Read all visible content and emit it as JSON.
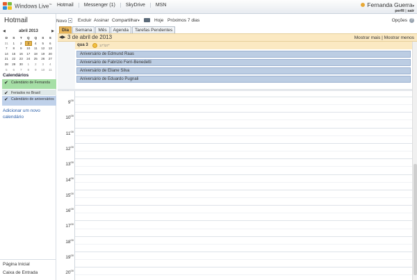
{
  "topbar": {
    "logo_text": "Windows Live",
    "logo_tm": "™",
    "nav": [
      "Hotmail",
      "Messenger (1)",
      "SkyDrive",
      "MSN"
    ],
    "user_name": "Fernanda Guerra",
    "user_links": [
      "perfil",
      "sair"
    ]
  },
  "left": {
    "brand": "Hotmail",
    "mini_calendar": {
      "month_label": "abril 2013",
      "weekday_headers": [
        "D",
        "S",
        "T",
        "Q",
        "Q",
        "S",
        "S"
      ],
      "weeks": [
        [
          "31",
          "1",
          "2",
          "3",
          "4",
          "5",
          "6"
        ],
        [
          "7",
          "8",
          "9",
          "10",
          "11",
          "12",
          "13"
        ],
        [
          "14",
          "15",
          "16",
          "17",
          "18",
          "19",
          "20"
        ],
        [
          "21",
          "22",
          "23",
          "24",
          "25",
          "26",
          "27"
        ],
        [
          "28",
          "29",
          "30",
          "1",
          "2",
          "3",
          "4"
        ],
        [
          "5",
          "6",
          "7",
          "8",
          "9",
          "10",
          "11"
        ]
      ],
      "today": "3"
    },
    "calendars_title": "Calendários",
    "calendars": [
      {
        "label": "Calendário de Fernanda",
        "color": "#a6dfa6"
      },
      {
        "label": "Feriados no Brasil",
        "color": "#dfe8e8"
      },
      {
        "label": "Calendário de aniversários",
        "color": "#bfd1ea"
      }
    ],
    "add_calendar": "Adicionar um novo calendário",
    "bottom_links": [
      "Página Inicial",
      "Caixa de Entrada"
    ]
  },
  "toolbar": {
    "novo": "Novo",
    "excluir": "Excluir",
    "assinar": "Assinar",
    "compartilhar": "Compartilhar",
    "hoje": "Hoje",
    "proximos": "Próximos 7 dias",
    "opcoes": "Opções",
    "help": "?"
  },
  "tabs": [
    "Dia",
    "Semana",
    "Mês",
    "Agenda",
    "Tarefas Pendentes"
  ],
  "date_bar": {
    "title": "3 de abril de 2013",
    "mostrar_mais": "Mostrar mais",
    "mostrar_menos": "Mostrar menos"
  },
  "day": {
    "label": "qua 3",
    "weather": "17°/27°",
    "events": [
      "Aniversário de Edmund Raas",
      "Aniversário de Fabrizio Ferri-Benedetti",
      "Aniversário de Eliane Silva",
      "Aniversário de Eduardo Pugnali"
    ],
    "hours": [
      "9",
      "10",
      "11",
      "12",
      "13",
      "14",
      "15",
      "16",
      "17",
      "18",
      "19",
      "20"
    ],
    "hour_suffix": "00"
  },
  "colors": {
    "accent_tab": "#e9b65b",
    "date_bar": "#fbe9c2",
    "event": "#bccde3",
    "link": "#2b5fa8"
  }
}
